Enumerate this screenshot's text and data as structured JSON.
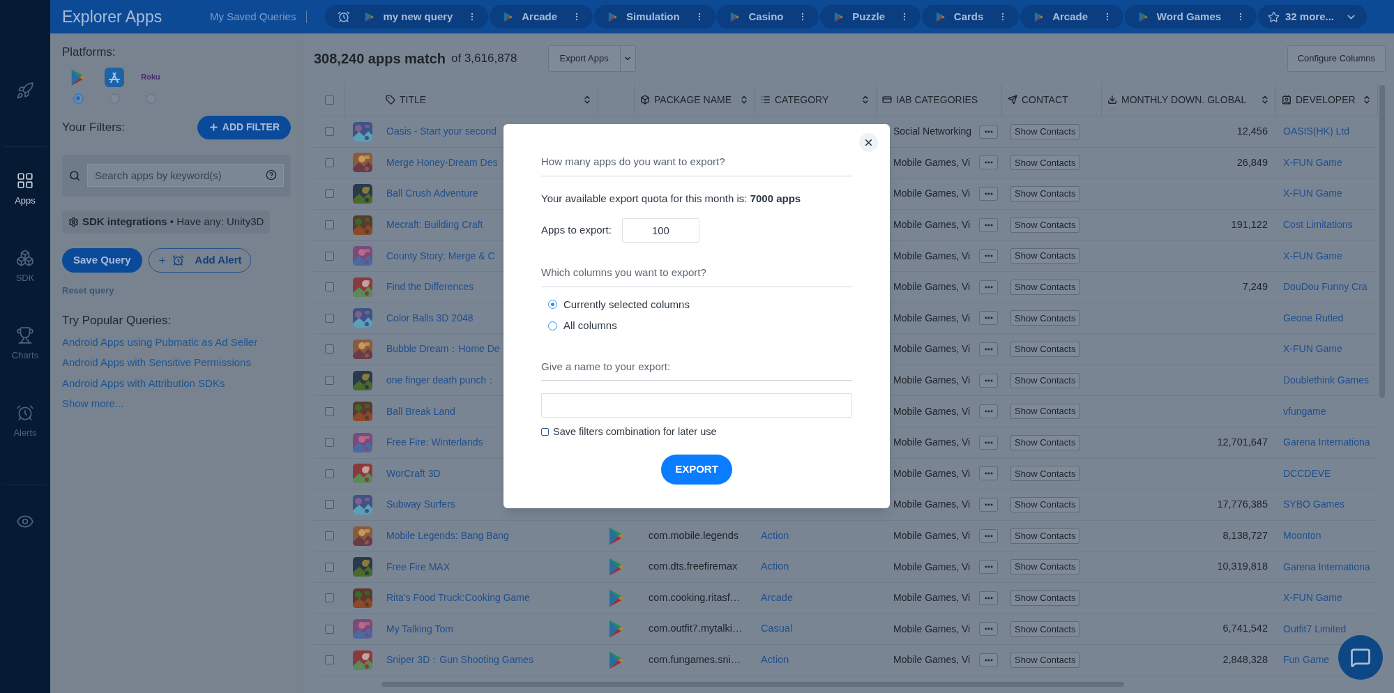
{
  "nav_rail": {
    "items": [
      {
        "kind": "rocket",
        "selected": false
      },
      {
        "kind": "apps",
        "label": "Apps",
        "selected": true
      },
      {
        "kind": "sdk",
        "label": "SDK",
        "selected": false
      },
      {
        "kind": "charts",
        "label": "Charts",
        "selected": false
      },
      {
        "kind": "alerts",
        "label": "Alerts",
        "selected": false
      },
      {
        "kind": "eye",
        "selected": false
      }
    ]
  },
  "top_bar": {
    "title": "Explorer Apps",
    "saved_label": "My Saved Queries",
    "queries": [
      {
        "label": "my new query",
        "alert": true
      },
      {
        "label": "Arcade",
        "alert": false
      },
      {
        "label": "Simulation",
        "alert": false
      },
      {
        "label": "Casino",
        "alert": false
      },
      {
        "label": "Puzzle",
        "alert": false
      },
      {
        "label": "Cards",
        "alert": false
      },
      {
        "label": "Arcade",
        "alert": false
      },
      {
        "label": "Word Games",
        "alert": false
      }
    ],
    "more": "32 more..."
  },
  "sidebar": {
    "platforms_label": "Platforms:",
    "platforms": [
      {
        "kind": "google_play",
        "selected": true
      },
      {
        "kind": "app_store",
        "selected": false
      },
      {
        "kind": "roku",
        "label": "Roku",
        "selected": false
      }
    ],
    "filters_label": "Your Filters:",
    "add_filter": "ADD FILTER",
    "search": {
      "placeholder": "Search apps by keyword(s)"
    },
    "filter_chip": "**SDK integrations** • Have any: Unity3D",
    "save_query": "Save Query",
    "add_alert": "Add Alert",
    "reset": "Reset query",
    "popular_label": "Try Popular Queries:",
    "popular": [
      "Android Apps using Pubmatic as Ad Seller",
      "Android Apps with Sensitive Permissions",
      "Android Apps with Attribution SDKs"
    ],
    "show_more": "Show more..."
  },
  "results": {
    "count": "308,240 apps match",
    "total": "of 3,616,878",
    "export_button": "Export Apps",
    "configure_button": "Configure Columns"
  },
  "table": {
    "select_all_checked": false,
    "columns": [
      {
        "kind": "title",
        "label": "TITLE",
        "sortable": true
      },
      {
        "kind": "package",
        "label": "PACKAGE NAME",
        "sortable": true
      },
      {
        "kind": "category",
        "label": "CATEGORY",
        "sortable": true
      },
      {
        "kind": "iab",
        "label": "IAB CATEGORIES",
        "sortable": false
      },
      {
        "kind": "contact",
        "label": "CONTACT",
        "sortable": false
      },
      {
        "kind": "downloads",
        "label": "MONTHLY DOWN. GLOBAL",
        "sortable": true
      },
      {
        "kind": "developer",
        "label": "DEVELOPER",
        "sortable": true
      }
    ],
    "rows": [
      {
        "checked": false,
        "title": "Oasis - Start your second",
        "iab": "Social Networking",
        "contact": "Show Contacts",
        "downloads": "12,456",
        "developer": "OASIS(HK) Ltd"
      },
      {
        "checked": false,
        "title": "Merge Honey-Dream Des",
        "iab": "Mobile Games, Vi",
        "contact": "Show Contacts",
        "downloads": "26,849",
        "developer": "X-FUN Game"
      },
      {
        "checked": false,
        "title": "Ball Crush Adventure",
        "iab": "Mobile Games, Vi",
        "contact": "Show Contacts",
        "developer": "X-FUN Game"
      },
      {
        "checked": false,
        "title": "Mecraft: Building Craft",
        "iab": "Mobile Games, Vi",
        "contact": "Show Contacts",
        "downloads": "191,122",
        "developer": "Cost Limitations"
      },
      {
        "checked": false,
        "title": "County Story: Merge & C",
        "iab": "Mobile Games, Vi",
        "contact": "Show Contacts",
        "developer": "X-FUN Game"
      },
      {
        "checked": false,
        "title": "Find the Differences",
        "iab": "Mobile Games, Vi",
        "contact": "Show Contacts",
        "downloads": "7,249",
        "developer": "DouDou Funny Cra"
      },
      {
        "checked": false,
        "title": "Color Balls 3D 2048",
        "iab": "Mobile Games, Vi",
        "contact": "Show Contacts",
        "developer": "Geone Rutled"
      },
      {
        "checked": false,
        "title": "Bubble Dream：Home De",
        "iab": "Mobile Games, Vi",
        "contact": "Show Contacts",
        "developer": "X-FUN Game"
      },
      {
        "checked": false,
        "title": "one finger death punch：",
        "iab": "Mobile Games, Vi",
        "contact": "Show Contacts",
        "developer": "Doublethink Games"
      },
      {
        "checked": false,
        "title": "Ball Break Land",
        "iab": "Mobile Games, Vi",
        "contact": "Show Contacts",
        "developer": "vfungame"
      },
      {
        "checked": false,
        "title": "Free Fire: Winterlands",
        "iab": "Mobile Games, Vi",
        "contact": "Show Contacts",
        "downloads": "12,701,647",
        "developer": "Garena Internationa"
      },
      {
        "checked": false,
        "title": "WorCraft 3D",
        "iab": "Mobile Games, Vi",
        "contact": "Show Contacts",
        "developer": "DCCDEVE"
      },
      {
        "checked": false,
        "title": "Subway Surfers",
        "iab": "Mobile Games, Vi",
        "contact": "Show Contacts",
        "downloads": "17,776,385",
        "developer": "SYBO Games"
      },
      {
        "checked": false,
        "title": "Mobile Legends: Bang Bang",
        "store_icon": true,
        "package": "com.mobile.legends",
        "category": "Action",
        "iab": "Mobile Games, Vi",
        "contact": "Show Contacts",
        "downloads": "8,138,727",
        "developer": "Moonton"
      },
      {
        "checked": false,
        "title": "Free Fire MAX",
        "store_icon": true,
        "package": "com.dts.freefiremax",
        "category": "Action",
        "iab": "Mobile Games, Vi",
        "contact": "Show Contacts",
        "downloads": "10,319,818",
        "developer": "Garena Internationa"
      },
      {
        "checked": false,
        "title": "Rita's Food Truck:Cooking Game",
        "store_icon": true,
        "package": "com.cooking.ritasf…",
        "category": "Arcade",
        "iab": "Mobile Games, Vi",
        "contact": "Show Contacts",
        "developer": "X-FUN Game"
      },
      {
        "checked": false,
        "title": "My Talking Tom",
        "store_icon": true,
        "package": "com.outfit7.mytalki…",
        "category": "Casual",
        "iab": "Mobile Games, Vi",
        "contact": "Show Contacts",
        "downloads": "6,741,542",
        "developer": "Outfit7 Limited"
      },
      {
        "checked": false,
        "title": "Sniper 3D：Gun Shooting Games",
        "store_icon": true,
        "package": "com.fungames.sni…",
        "category": "Action",
        "iab": "Mobile Games, Vi",
        "contact": "Show Contacts",
        "downloads": "2,848,328",
        "developer": "Fun Game"
      }
    ]
  },
  "modal": {
    "quota_heading": "How many apps do you want to export?",
    "quota_text": "Your available export quota for this month is: **7000 apps**",
    "apps_label": "Apps to export:",
    "apps_value": "100",
    "columns_heading": "Which columns you want to export?",
    "column_options": [
      {
        "label": "Currently selected columns",
        "selected": true
      },
      {
        "label": "All columns",
        "selected": false
      }
    ],
    "name_heading": "Give a name to your export:",
    "save_filters": {
      "label": "Save filters combination for later use",
      "checked": false
    },
    "export_button": "EXPORT"
  }
}
